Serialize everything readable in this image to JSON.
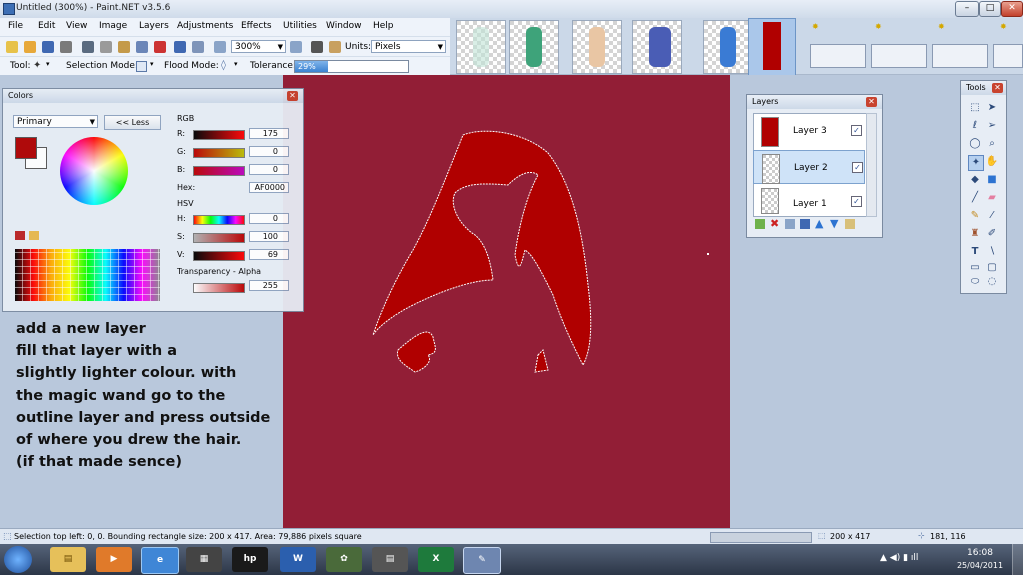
{
  "window": {
    "title": "Untitled (300%) - Paint.NET v3.5.6",
    "minimize": "–",
    "maximize": "□",
    "close": "✕"
  },
  "menu": [
    "File",
    "Edit",
    "View",
    "Image",
    "Layers",
    "Adjustments",
    "Effects",
    "Utilities",
    "Window",
    "Help"
  ],
  "toolbar": {
    "zoom_value": "300%",
    "units_label": "Units:",
    "units_value": "Pixels",
    "tool_label": "Tool:",
    "selection_mode_label": "Selection Mode:",
    "flood_mode_label": "Flood Mode:",
    "tolerance_label": "Tolerance:",
    "tolerance_value": "29%",
    "tolerance_fraction": 0.29
  },
  "colors_panel": {
    "title": "Colors",
    "primary_select": "Primary",
    "less_button": "<< Less",
    "rgb_label": "RGB",
    "r_label": "R:",
    "r_value": "175",
    "g_label": "G:",
    "g_value": "0",
    "b_label": "B:",
    "b_value": "0",
    "hex_label": "Hex:",
    "hex_value": "AF0000",
    "hsv_label": "HSV",
    "h_label": "H:",
    "h_value": "0",
    "s_label": "S:",
    "s_value": "100",
    "v_label": "V:",
    "v_value": "69",
    "alpha_label": "Transparency - Alpha",
    "alpha_value": "255",
    "primary_color": "#af0000",
    "secondary_color": "#ffffff"
  },
  "layers_panel": {
    "title": "Layers",
    "layers": [
      {
        "name": "Layer 3",
        "checked": "✓"
      },
      {
        "name": "Layer 2",
        "checked": "✓"
      },
      {
        "name": "Layer 1",
        "checked": "✓"
      }
    ]
  },
  "tools_panel": {
    "title": "Tools",
    "text_tool": "T"
  },
  "instructions": [
    "add a new layer",
    "fill that layer with a",
    "slightly lighter colour. with",
    "the magic wand go to the",
    "outline layer and press outside",
    "of where you drew the hair.",
    "(if that made sence)"
  ],
  "statusbar": {
    "selection_info": "Selection top left: 0, 0. Bounding rectangle size: 200 x 417. Area: 79,886 pixels square",
    "image_size": "200 x 417",
    "cursor_pos": "181, 116"
  },
  "taskbar": {
    "time": "16:08",
    "date": "25/04/2011"
  },
  "colors": {
    "canvas_bg": "#921e36",
    "hair_fill": "#b00000"
  }
}
